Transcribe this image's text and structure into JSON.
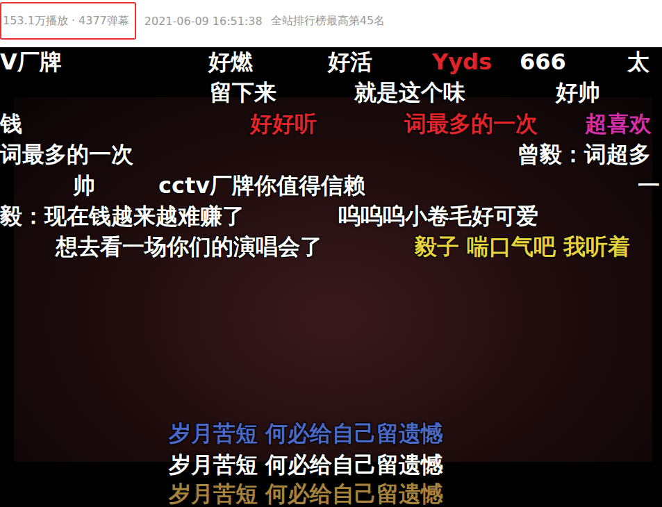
{
  "meta": {
    "stats": "153.1万播放 · 4377弹幕",
    "time": "2021-06-09 16:51:38",
    "rank": "全站排行榜最高第45名"
  },
  "danmaku": [
    {
      "text": "V厂牌",
      "color": "#ffffff"
    },
    {
      "text": "好燃",
      "color": "#ffffff"
    },
    {
      "text": "好活",
      "color": "#ffffff"
    },
    {
      "text": "Yyds",
      "color": "#e0242a"
    },
    {
      "text": "666",
      "color": "#ffffff"
    },
    {
      "text": "太",
      "color": "#ffffff"
    },
    {
      "text": "留下来",
      "color": "#ffffff"
    },
    {
      "text": "就是这个味",
      "color": "#ffffff"
    },
    {
      "text": "好帅",
      "color": "#ffffff"
    },
    {
      "text": "钱",
      "color": "#ffffff"
    },
    {
      "text": "好好听",
      "color": "#e0242a"
    },
    {
      "text": "词最多的一次",
      "color": "#e0242a"
    },
    {
      "text": "超喜欢",
      "color": "#d62fa8"
    },
    {
      "text": "词最多的一次",
      "color": "#ffffff"
    },
    {
      "text": "曾毅：词超多",
      "color": "#ffffff"
    },
    {
      "text": "帅",
      "color": "#ffffff"
    },
    {
      "text": "cctv厂牌你值得信赖",
      "color": "#ffffff"
    },
    {
      "text": "一",
      "color": "#ffffff"
    },
    {
      "text": "毅：现在钱越来越难赚了",
      "color": "#ffffff"
    },
    {
      "text": "呜呜呜小卷毛好可爱",
      "color": "#ffffff"
    },
    {
      "text": "想去看一场你们的演唱会了",
      "color": "#ffffff"
    },
    {
      "text": "毅子 喘口气吧 我听着",
      "color": "#e6d23c"
    },
    {
      "text": "岁月苦短 何必给自己留遗憾",
      "color": "#4a68c4"
    },
    {
      "text": "岁月苦短 何必给自己留遗憾",
      "color": "#ffffff"
    },
    {
      "text": "岁月苦短 何必给自己留遗憾",
      "color": "#a6823c"
    }
  ]
}
